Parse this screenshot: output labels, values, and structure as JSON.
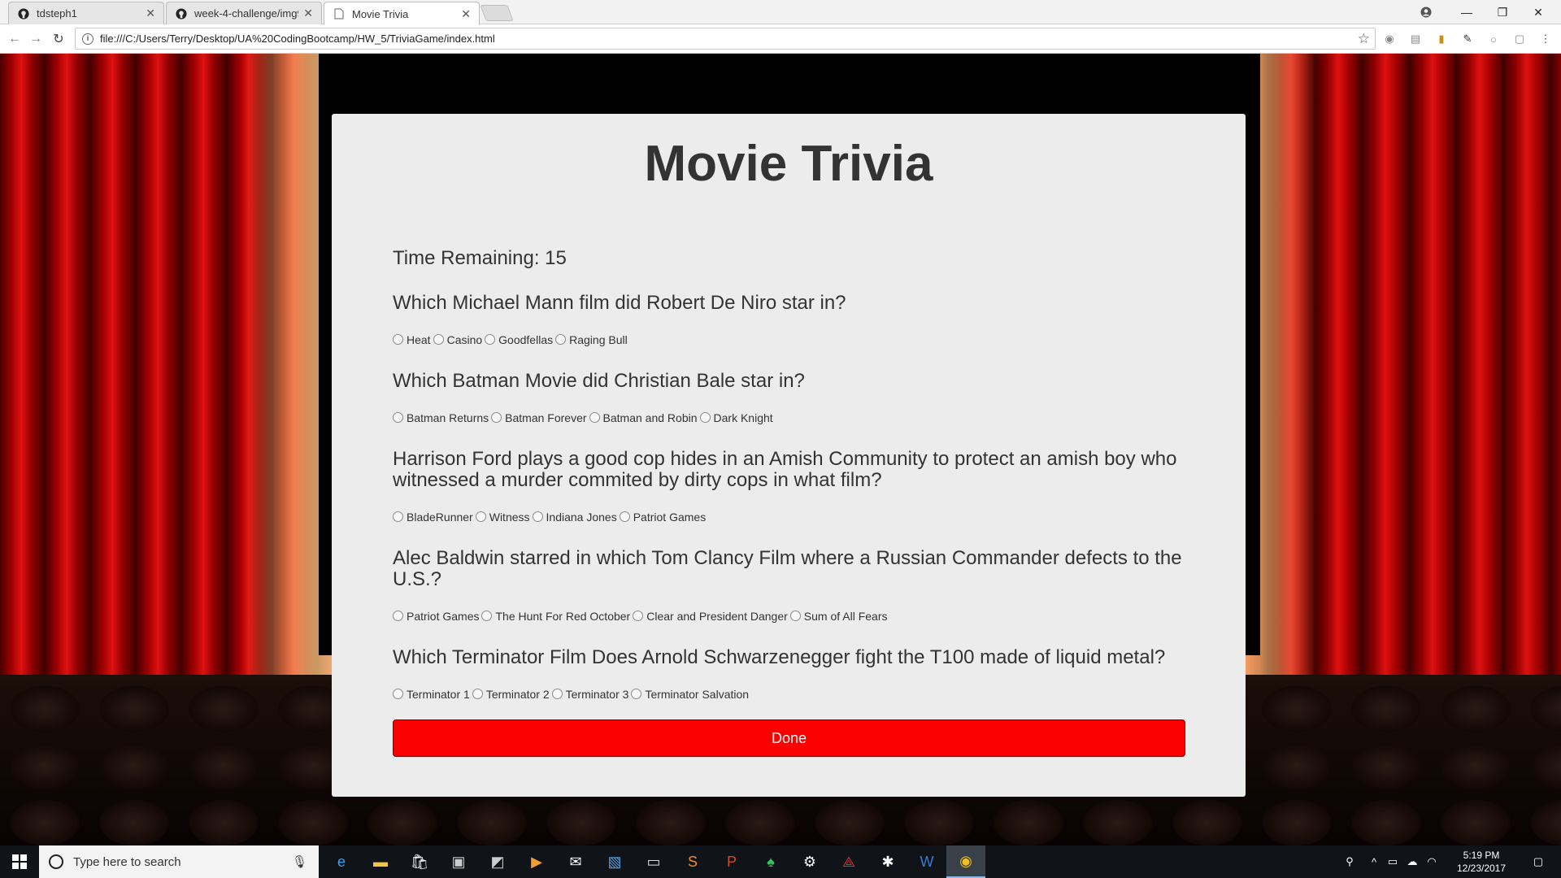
{
  "browser": {
    "tabs": [
      {
        "title": "tdsteph1",
        "icon": "github-icon"
      },
      {
        "title": "week-4-challenge/img9.j",
        "icon": "github-icon"
      },
      {
        "title": "Movie Trivia",
        "icon": "page-icon",
        "active": true
      }
    ],
    "url": "file:///C:/Users/Terry/Desktop/UA%20CodingBootcamp/HW_5/TriviaGame/index.html"
  },
  "page": {
    "title": "Movie Trivia",
    "timer_label": "Time Remaining: 15",
    "questions": [
      {
        "text": "Which Michael Mann film did Robert De Niro star in?",
        "options": [
          "Heat",
          "Casino",
          "Goodfellas",
          "Raging Bull"
        ]
      },
      {
        "text": "Which Batman Movie did Christian Bale star in?",
        "options": [
          "Batman Returns",
          "Batman Forever",
          "Batman and Robin",
          "Dark Knight"
        ]
      },
      {
        "text": "Harrison Ford plays a good cop hides in an Amish Community to protect an amish boy who witnessed a murder commited by dirty cops in what film?",
        "options": [
          "BladeRunner",
          "Witness",
          "Indiana Jones",
          "Patriot Games"
        ]
      },
      {
        "text": "Alec Baldwin starred in which Tom Clancy Film where a Russian Commander defects to the U.S.?",
        "options": [
          "Patriot Games",
          "The Hunt For Red October",
          "Clear and President Danger",
          "Sum of All Fears"
        ]
      },
      {
        "text": "Which Terminator Film Does Arnold Schwarzenegger fight the T100 made of liquid metal?",
        "options": [
          "Terminator 1",
          "Terminator 2",
          "Terminator 3",
          "Terminator Salvation"
        ]
      }
    ],
    "done_label": "Done",
    "colors": {
      "card_bg": "#ececec",
      "done_button": "#fb0000",
      "text": "#333333"
    }
  },
  "taskbar": {
    "search_placeholder": "Type here to search",
    "time": "5:19 PM",
    "date": "12/23/2017"
  }
}
